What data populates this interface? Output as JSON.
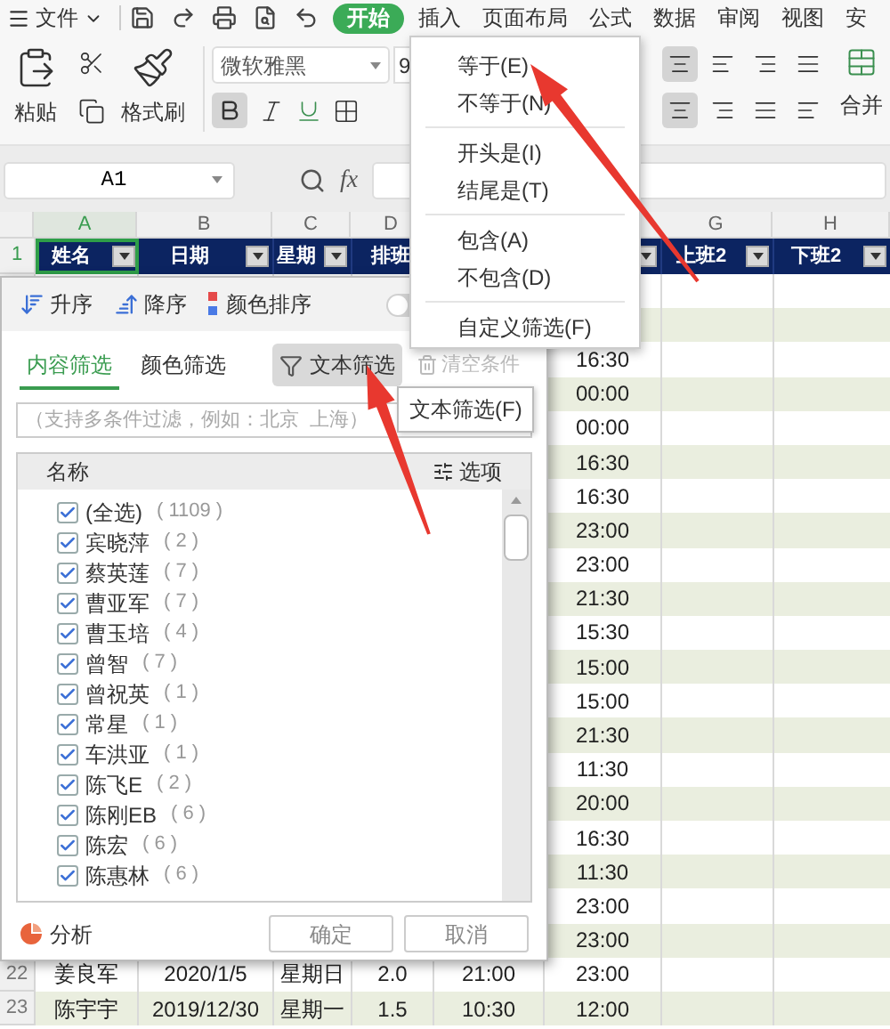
{
  "menu_bar": {
    "file_label": "文件",
    "tabs": [
      {
        "label": "开始",
        "selected": true
      },
      {
        "label": "插入",
        "selected": false
      },
      {
        "label": "页面布局",
        "selected": false
      },
      {
        "label": "公式",
        "selected": false
      },
      {
        "label": "数据",
        "selected": false
      },
      {
        "label": "审阅",
        "selected": false
      },
      {
        "label": "视图",
        "selected": false
      },
      {
        "label": "安",
        "selected": false
      }
    ]
  },
  "ribbon": {
    "paste_label": "粘贴",
    "format_painter_label": "格式刷",
    "font_name": "微软雅黑",
    "font_size": "9",
    "bold_selected": true,
    "align_top": [
      {
        "selected": true
      },
      {
        "selected": false
      },
      {
        "selected": false
      },
      {
        "selected": false
      }
    ],
    "align_bottom": [
      {
        "selected": true
      },
      {
        "selected": false
      },
      {
        "selected": false
      },
      {
        "selected": false
      }
    ],
    "merge_label": "合并"
  },
  "formula_bar": {
    "cell_ref": "A1",
    "fx": "fx"
  },
  "sheet": {
    "columns": [
      {
        "letter": "A",
        "selected": true
      },
      {
        "letter": "B",
        "selected": false
      },
      {
        "letter": "C",
        "selected": false
      },
      {
        "letter": "D",
        "selected": false
      },
      {
        "letter": "G",
        "selected": false
      },
      {
        "letter": "H",
        "selected": false
      }
    ],
    "header_row": {
      "label": "1",
      "cells": [
        {
          "text": "姓名",
          "dropdown": true,
          "selected": true
        },
        {
          "text": "日期",
          "dropdown": true,
          "selected": false
        },
        {
          "text": "星期",
          "dropdown": true,
          "selected": false
        },
        {
          "text": "排班",
          "dropdown": false,
          "selected": false
        },
        {
          "dropdown": true,
          "selected": false
        },
        {
          "text": "上班2",
          "dropdown": true,
          "selected": false
        },
        {
          "text": "下班2",
          "dropdown": true,
          "selected": false
        }
      ]
    },
    "rows": [
      {
        "cells": {
          "F": "16:30"
        }
      },
      {
        "cells": {
          "F": "00:00"
        }
      },
      {
        "cells": {
          "F": "00:00"
        }
      },
      {
        "cells": {
          "F": "16:30"
        }
      },
      {
        "cells": {
          "F": "16:30"
        }
      },
      {
        "cells": {
          "F": "23:00"
        }
      },
      {
        "cells": {
          "F": "23:00"
        }
      },
      {
        "cells": {
          "F": "21:30"
        }
      },
      {
        "cells": {
          "F": "15:30"
        }
      },
      {
        "cells": {
          "F": "15:00"
        }
      },
      {
        "cells": {
          "F": "15:00"
        }
      },
      {
        "cells": {
          "F": "21:30"
        }
      },
      {
        "cells": {
          "F": "11:30"
        }
      },
      {
        "cells": {
          "F": "20:00"
        }
      },
      {
        "cells": {
          "F": "16:30"
        }
      },
      {
        "cells": {
          "F": "11:30"
        }
      },
      {
        "cells": {
          "F": "23:00"
        }
      },
      {
        "cells": {
          "F": "23:00"
        }
      },
      {
        "label": "22",
        "cells": {
          "A": "姜良军",
          "B": "2020/1/5",
          "C": "星期日",
          "D": "2.0",
          "E": "21:00",
          "F": "23:00"
        }
      },
      {
        "label": "23",
        "cells": {
          "A": "陈宇宇",
          "B": "2019/12/30",
          "C": "星期一",
          "D": "1.5",
          "E": "10:30",
          "F": "12:00"
        }
      }
    ]
  },
  "filter_panel": {
    "sort_ascending": "升序",
    "sort_descending": "降序",
    "sort_by_color": "颜色排序",
    "toggle": {
      "on": false
    },
    "tabs": [
      {
        "label": "内容筛选",
        "selected": true
      },
      {
        "label": "颜色筛选",
        "selected": false
      }
    ],
    "text_filter_button": "文本筛选",
    "clear_button": {
      "label": "清空条件",
      "disabled": true
    },
    "search_placeholder": "（支持多条件过滤，例如：北京  上海）",
    "list_header": "名称",
    "options_label": "选项",
    "items": [
      {
        "label": "(全选)",
        "count": "( 1109 )",
        "checked": true
      },
      {
        "label": "宾晓萍",
        "count": "( 2 )",
        "checked": true
      },
      {
        "label": "蔡英莲",
        "count": "( 7 )",
        "checked": true
      },
      {
        "label": "曹亚军",
        "count": "( 7 )",
        "checked": true
      },
      {
        "label": "曹玉培",
        "count": "( 4 )",
        "checked": true
      },
      {
        "label": "曾智",
        "count": "( 7 )",
        "checked": true
      },
      {
        "label": "曾祝英",
        "count": "( 1 )",
        "checked": true
      },
      {
        "label": "常星",
        "count": "( 1 )",
        "checked": true
      },
      {
        "label": "车洪亚",
        "count": "( 1 )",
        "checked": true
      },
      {
        "label": "陈飞E",
        "count": "( 2 )",
        "checked": true
      },
      {
        "label": "陈刚EB",
        "count": "( 6 )",
        "checked": true
      },
      {
        "label": "陈宏",
        "count": "( 6 )",
        "checked": true
      },
      {
        "label": "陈惠林",
        "count": "( 6 )",
        "checked": true
      }
    ],
    "analyze_label": "分析",
    "ok_button": "确定",
    "cancel_button": "取消"
  },
  "text_filter_menu": {
    "groups": [
      [
        "等于(E)",
        "不等于(N)"
      ],
      [
        "开头是(I)",
        "结尾是(T)"
      ],
      [
        "包含(A)",
        "不包含(D)"
      ],
      [
        "自定义筛选(F)"
      ]
    ]
  },
  "tooltip": "文本筛选(F)"
}
